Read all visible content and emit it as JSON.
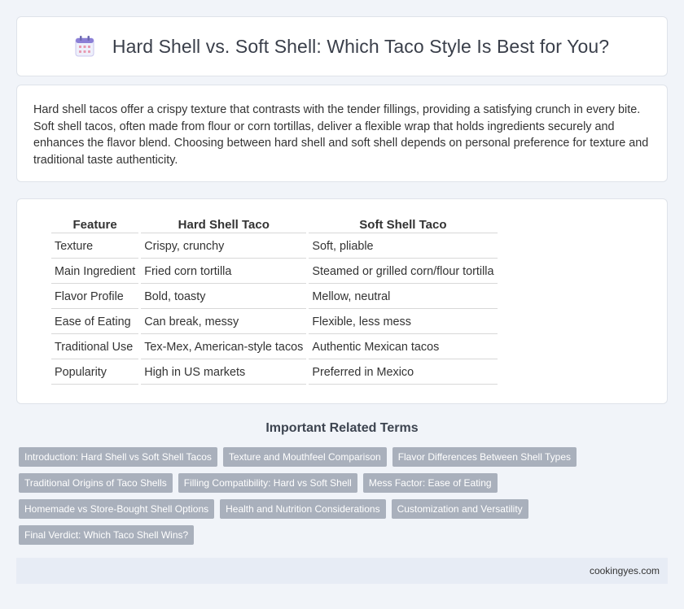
{
  "header": {
    "title": "Hard Shell vs. Soft Shell: Which Taco Style Is Best for You?",
    "icon": "calendar-icon"
  },
  "intro": {
    "text": "Hard shell tacos offer a crispy texture that contrasts with the tender fillings, providing a satisfying crunch in every bite. Soft shell tacos, often made from flour or corn tortillas, deliver a flexible wrap that holds ingredients securely and enhances the flavor blend. Choosing between hard shell and soft shell depends on personal preference for texture and traditional taste authenticity."
  },
  "table": {
    "headers": [
      "Feature",
      "Hard Shell Taco",
      "Soft Shell Taco"
    ],
    "rows": [
      [
        "Texture",
        "Crispy, crunchy",
        "Soft, pliable"
      ],
      [
        "Main Ingredient",
        "Fried corn tortilla",
        "Steamed or grilled corn/flour tortilla"
      ],
      [
        "Flavor Profile",
        "Bold, toasty",
        "Mellow, neutral"
      ],
      [
        "Ease of Eating",
        "Can break, messy",
        "Flexible, less mess"
      ],
      [
        "Traditional Use",
        "Tex-Mex, American-style tacos",
        "Authentic Mexican tacos"
      ],
      [
        "Popularity",
        "High in US markets",
        "Preferred in Mexico"
      ]
    ]
  },
  "related": {
    "title": "Important Related Terms",
    "tags": [
      "Introduction: Hard Shell vs Soft Shell Tacos",
      "Texture and Mouthfeel Comparison",
      "Flavor Differences Between Shell Types",
      "Traditional Origins of Taco Shells",
      "Filling Compatibility: Hard vs Soft Shell",
      "Mess Factor: Ease of Eating",
      "Homemade vs Store-Bought Shell Options",
      "Health and Nutrition Considerations",
      "Customization and Versatility",
      "Final Verdict: Which Taco Shell Wins?"
    ]
  },
  "footer": {
    "site": "cookingyes.com"
  },
  "colors": {
    "background": "#f1f4f9",
    "tag_bg": "#a9b0bc",
    "footer_bg": "#e7ecf5",
    "icon_accent": "#8b7fd6"
  }
}
